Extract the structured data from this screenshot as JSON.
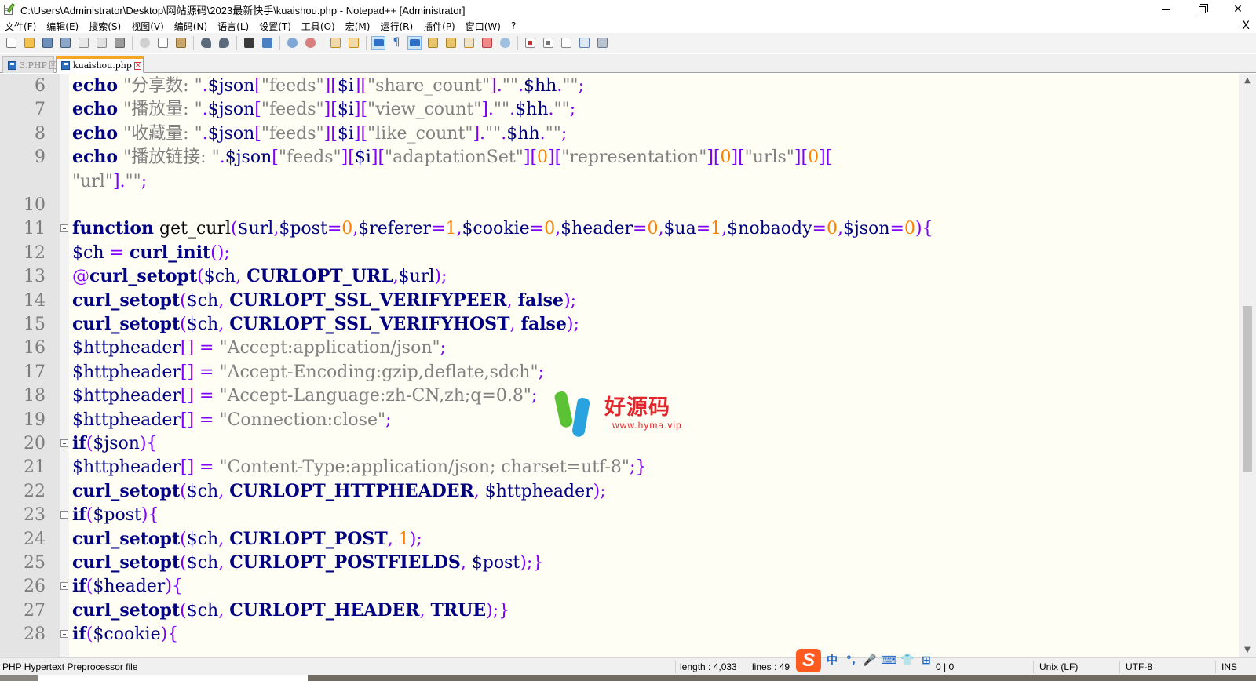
{
  "window": {
    "title": "C:\\Users\\Administrator\\Desktop\\网站源码\\2023最新快手\\kuaishou.php - Notepad++ [Administrator]",
    "close_glyph": "✕"
  },
  "menu": {
    "items": [
      "文件(F)",
      "编辑(E)",
      "搜索(S)",
      "视图(V)",
      "编码(N)",
      "语言(L)",
      "设置(T)",
      "工具(O)",
      "宏(M)",
      "运行(R)",
      "插件(P)",
      "窗口(W)",
      "?"
    ],
    "close_label": "X"
  },
  "tabs": [
    {
      "label": "3.PHP",
      "active": false
    },
    {
      "label": "kuaishou.php",
      "active": true
    }
  ],
  "editor": {
    "lines": [
      {
        "num": "6",
        "fold": ""
      },
      {
        "num": "7",
        "fold": ""
      },
      {
        "num": "8",
        "fold": ""
      },
      {
        "num": "9",
        "fold": ""
      },
      {
        "num": "",
        "fold": ""
      },
      {
        "num": "10",
        "fold": ""
      },
      {
        "num": "11",
        "fold": "open"
      },
      {
        "num": "12",
        "fold": ""
      },
      {
        "num": "13",
        "fold": ""
      },
      {
        "num": "14",
        "fold": ""
      },
      {
        "num": "15",
        "fold": ""
      },
      {
        "num": "16",
        "fold": ""
      },
      {
        "num": "17",
        "fold": ""
      },
      {
        "num": "18",
        "fold": ""
      },
      {
        "num": "19",
        "fold": ""
      },
      {
        "num": "20",
        "fold": "open"
      },
      {
        "num": "21",
        "fold": ""
      },
      {
        "num": "22",
        "fold": ""
      },
      {
        "num": "23",
        "fold": "open"
      },
      {
        "num": "24",
        "fold": ""
      },
      {
        "num": "25",
        "fold": ""
      },
      {
        "num": "26",
        "fold": "open"
      },
      {
        "num": "27",
        "fold": ""
      },
      {
        "num": "28",
        "fold": "open"
      }
    ],
    "code": [
      [
        [
          "kw",
          "echo"
        ],
        [
          "txt",
          " "
        ],
        [
          "str",
          "\"分享数: \""
        ],
        [
          "op",
          "."
        ],
        [
          "var",
          "$json"
        ],
        [
          "op",
          "["
        ],
        [
          "str",
          "\"feeds\""
        ],
        [
          "op",
          "]["
        ],
        [
          "var",
          "$i"
        ],
        [
          "op",
          "]["
        ],
        [
          "str",
          "\"share_count\""
        ],
        [
          "op",
          "]."
        ],
        [
          "str",
          "\"\""
        ],
        [
          "op",
          "."
        ],
        [
          "var",
          "$hh"
        ],
        [
          "op",
          "."
        ],
        [
          "str",
          "\"\""
        ],
        [
          "op",
          ";"
        ]
      ],
      [
        [
          "kw",
          "echo"
        ],
        [
          "txt",
          " "
        ],
        [
          "str",
          "\"播放量: \""
        ],
        [
          "op",
          "."
        ],
        [
          "var",
          "$json"
        ],
        [
          "op",
          "["
        ],
        [
          "str",
          "\"feeds\""
        ],
        [
          "op",
          "]["
        ],
        [
          "var",
          "$i"
        ],
        [
          "op",
          "]["
        ],
        [
          "str",
          "\"view_count\""
        ],
        [
          "op",
          "]."
        ],
        [
          "str",
          "\"\""
        ],
        [
          "op",
          "."
        ],
        [
          "var",
          "$hh"
        ],
        [
          "op",
          "."
        ],
        [
          "str",
          "\"\""
        ],
        [
          "op",
          ";"
        ]
      ],
      [
        [
          "kw",
          "echo"
        ],
        [
          "txt",
          " "
        ],
        [
          "str",
          "\"收藏量: \""
        ],
        [
          "op",
          "."
        ],
        [
          "var",
          "$json"
        ],
        [
          "op",
          "["
        ],
        [
          "str",
          "\"feeds\""
        ],
        [
          "op",
          "]["
        ],
        [
          "var",
          "$i"
        ],
        [
          "op",
          "]["
        ],
        [
          "str",
          "\"like_count\""
        ],
        [
          "op",
          "]."
        ],
        [
          "str",
          "\"\""
        ],
        [
          "op",
          "."
        ],
        [
          "var",
          "$hh"
        ],
        [
          "op",
          "."
        ],
        [
          "str",
          "\"\""
        ],
        [
          "op",
          ";"
        ]
      ],
      [
        [
          "kw",
          "echo"
        ],
        [
          "txt",
          " "
        ],
        [
          "str",
          "\"播放链接: \""
        ],
        [
          "op",
          "."
        ],
        [
          "var",
          "$json"
        ],
        [
          "op",
          "["
        ],
        [
          "str",
          "\"feeds\""
        ],
        [
          "op",
          "]["
        ],
        [
          "var",
          "$i"
        ],
        [
          "op",
          "]["
        ],
        [
          "str",
          "\"adaptationSet\""
        ],
        [
          "op",
          "]["
        ],
        [
          "num",
          "0"
        ],
        [
          "op",
          "]["
        ],
        [
          "str",
          "\"representation\""
        ],
        [
          "op",
          "]["
        ],
        [
          "num",
          "0"
        ],
        [
          "op",
          "]["
        ],
        [
          "str",
          "\"urls\""
        ],
        [
          "op",
          "]["
        ],
        [
          "num",
          "0"
        ],
        [
          "op",
          "]["
        ]
      ],
      [
        [
          "str",
          "\"url\""
        ],
        [
          "op",
          "]."
        ],
        [
          "str",
          "\"\""
        ],
        [
          "op",
          ";"
        ]
      ],
      [],
      [
        [
          "kw",
          "function"
        ],
        [
          "txt",
          " get_curl"
        ],
        [
          "op",
          "("
        ],
        [
          "var",
          "$url"
        ],
        [
          "op",
          ","
        ],
        [
          "var",
          "$post"
        ],
        [
          "op",
          "="
        ],
        [
          "num",
          "0"
        ],
        [
          "op",
          ","
        ],
        [
          "var",
          "$referer"
        ],
        [
          "op",
          "="
        ],
        [
          "num",
          "1"
        ],
        [
          "op",
          ","
        ],
        [
          "var",
          "$cookie"
        ],
        [
          "op",
          "="
        ],
        [
          "num",
          "0"
        ],
        [
          "op",
          ","
        ],
        [
          "var",
          "$header"
        ],
        [
          "op",
          "="
        ],
        [
          "num",
          "0"
        ],
        [
          "op",
          ","
        ],
        [
          "var",
          "$ua"
        ],
        [
          "op",
          "="
        ],
        [
          "num",
          "1"
        ],
        [
          "op",
          ","
        ],
        [
          "var",
          "$nobaody"
        ],
        [
          "op",
          "="
        ],
        [
          "num",
          "0"
        ],
        [
          "op",
          ","
        ],
        [
          "var",
          "$json"
        ],
        [
          "op",
          "="
        ],
        [
          "num",
          "0"
        ],
        [
          "op",
          "){"
        ]
      ],
      [
        [
          "var",
          "$ch"
        ],
        [
          "txt",
          " "
        ],
        [
          "op",
          "="
        ],
        [
          "txt",
          " "
        ],
        [
          "fn",
          "curl_init"
        ],
        [
          "op",
          "();"
        ]
      ],
      [
        [
          "op",
          "@"
        ],
        [
          "fn",
          "curl_setopt"
        ],
        [
          "op",
          "("
        ],
        [
          "var",
          "$ch"
        ],
        [
          "op",
          ","
        ],
        [
          "txt",
          " "
        ],
        [
          "fn",
          "CURLOPT_URL"
        ],
        [
          "op",
          ","
        ],
        [
          "var",
          "$url"
        ],
        [
          "op",
          ");"
        ]
      ],
      [
        [
          "fn",
          "curl_setopt"
        ],
        [
          "op",
          "("
        ],
        [
          "var",
          "$ch"
        ],
        [
          "op",
          ","
        ],
        [
          "txt",
          " "
        ],
        [
          "fn",
          "CURLOPT_SSL_VERIFYPEER"
        ],
        [
          "op",
          ","
        ],
        [
          "txt",
          " "
        ],
        [
          "fn",
          "false"
        ],
        [
          "op",
          ");"
        ]
      ],
      [
        [
          "fn",
          "curl_setopt"
        ],
        [
          "op",
          "("
        ],
        [
          "var",
          "$ch"
        ],
        [
          "op",
          ","
        ],
        [
          "txt",
          " "
        ],
        [
          "fn",
          "CURLOPT_SSL_VERIFYHOST"
        ],
        [
          "op",
          ","
        ],
        [
          "txt",
          " "
        ],
        [
          "fn",
          "false"
        ],
        [
          "op",
          ");"
        ]
      ],
      [
        [
          "var",
          "$httpheader"
        ],
        [
          "op",
          "[]"
        ],
        [
          "txt",
          " "
        ],
        [
          "op",
          "="
        ],
        [
          "txt",
          " "
        ],
        [
          "str",
          "\"Accept:application/json\""
        ],
        [
          "op",
          ";"
        ]
      ],
      [
        [
          "var",
          "$httpheader"
        ],
        [
          "op",
          "[]"
        ],
        [
          "txt",
          " "
        ],
        [
          "op",
          "="
        ],
        [
          "txt",
          " "
        ],
        [
          "str",
          "\"Accept-Encoding:gzip,deflate,sdch\""
        ],
        [
          "op",
          ";"
        ]
      ],
      [
        [
          "var",
          "$httpheader"
        ],
        [
          "op",
          "[]"
        ],
        [
          "txt",
          " "
        ],
        [
          "op",
          "="
        ],
        [
          "txt",
          " "
        ],
        [
          "str",
          "\"Accept-Language:zh-CN,zh;q=0.8\""
        ],
        [
          "op",
          ";"
        ]
      ],
      [
        [
          "var",
          "$httpheader"
        ],
        [
          "op",
          "[]"
        ],
        [
          "txt",
          " "
        ],
        [
          "op",
          "="
        ],
        [
          "txt",
          " "
        ],
        [
          "str",
          "\"Connection:close\""
        ],
        [
          "op",
          ";"
        ]
      ],
      [
        [
          "kw",
          "if"
        ],
        [
          "op",
          "("
        ],
        [
          "var",
          "$json"
        ],
        [
          "op",
          "){"
        ]
      ],
      [
        [
          "var",
          "$httpheader"
        ],
        [
          "op",
          "[]"
        ],
        [
          "txt",
          " "
        ],
        [
          "op",
          "="
        ],
        [
          "txt",
          " "
        ],
        [
          "str",
          "\"Content-Type:application/json; charset=utf-8\""
        ],
        [
          "op",
          ";}"
        ]
      ],
      [
        [
          "fn",
          "curl_setopt"
        ],
        [
          "op",
          "("
        ],
        [
          "var",
          "$ch"
        ],
        [
          "op",
          ","
        ],
        [
          "txt",
          " "
        ],
        [
          "fn",
          "CURLOPT_HTTPHEADER"
        ],
        [
          "op",
          ","
        ],
        [
          "txt",
          " "
        ],
        [
          "var",
          "$httpheader"
        ],
        [
          "op",
          ");"
        ]
      ],
      [
        [
          "kw",
          "if"
        ],
        [
          "op",
          "("
        ],
        [
          "var",
          "$post"
        ],
        [
          "op",
          "){"
        ]
      ],
      [
        [
          "fn",
          "curl_setopt"
        ],
        [
          "op",
          "("
        ],
        [
          "var",
          "$ch"
        ],
        [
          "op",
          ","
        ],
        [
          "txt",
          " "
        ],
        [
          "fn",
          "CURLOPT_POST"
        ],
        [
          "op",
          ","
        ],
        [
          "txt",
          " "
        ],
        [
          "num",
          "1"
        ],
        [
          "op",
          ");"
        ]
      ],
      [
        [
          "fn",
          "curl_setopt"
        ],
        [
          "op",
          "("
        ],
        [
          "var",
          "$ch"
        ],
        [
          "op",
          ","
        ],
        [
          "txt",
          " "
        ],
        [
          "fn",
          "CURLOPT_POSTFIELDS"
        ],
        [
          "op",
          ","
        ],
        [
          "txt",
          " "
        ],
        [
          "var",
          "$post"
        ],
        [
          "op",
          ");}"
        ]
      ],
      [
        [
          "kw",
          "if"
        ],
        [
          "op",
          "("
        ],
        [
          "var",
          "$header"
        ],
        [
          "op",
          "){"
        ]
      ],
      [
        [
          "fn",
          "curl_setopt"
        ],
        [
          "op",
          "("
        ],
        [
          "var",
          "$ch"
        ],
        [
          "op",
          ","
        ],
        [
          "txt",
          " "
        ],
        [
          "fn",
          "CURLOPT_HEADER"
        ],
        [
          "op",
          ","
        ],
        [
          "txt",
          " "
        ],
        [
          "fn",
          "TRUE"
        ],
        [
          "op",
          ");}"
        ]
      ],
      [
        [
          "kw",
          "if"
        ],
        [
          "op",
          "("
        ],
        [
          "var",
          "$cookie"
        ],
        [
          "op",
          "){"
        ]
      ]
    ]
  },
  "watermark": {
    "text": "好源码",
    "url": "www.hyma.vip"
  },
  "status": {
    "file_type": "PHP Hypertext Preprocessor file",
    "length": "length : 4,033",
    "lines": "lines : 49",
    "pos": "0 | 0",
    "eol": "Unix (LF)",
    "encoding": "UTF-8",
    "mode": "INS"
  },
  "ime": {
    "logo": "S",
    "items": [
      "中",
      "°,",
      "🎤",
      "⌨",
      "👕",
      "⊞"
    ]
  },
  "colors": {
    "keyword": "#000080",
    "string": "#808080",
    "operator": "#8000ff",
    "number": "#ff8000",
    "tab_accent": "#f5a623"
  }
}
